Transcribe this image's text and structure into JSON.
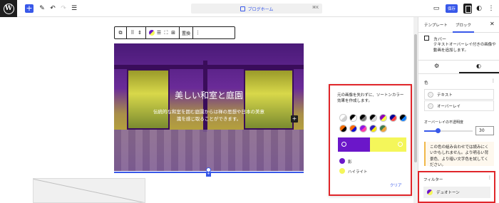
{
  "topbar": {
    "command_label": "ブログホーム",
    "command_shortcut": "⌘K",
    "save_label": "保存"
  },
  "block_toolbar": {
    "replace_label": "置換"
  },
  "cover": {
    "title": "美しい和室と庭園",
    "description": "伝統的な和室を囲む庭園からは禅の思想や日本の美意識を感じ取ることができます。"
  },
  "duotone": {
    "description": "元の画像を失わずに、ソートンカラー効果を作成します。",
    "presets": [
      {
        "a": "#ffffff",
        "b": "#d0d0d0"
      },
      {
        "a": "#000000",
        "b": "#ffffff"
      },
      {
        "a": "#000000",
        "b": "#7f7f7f"
      },
      {
        "a": "#000000",
        "b": "#d8d8d8"
      },
      {
        "a": "#8c00b7",
        "b": "#fcff41"
      },
      {
        "a": "#000097",
        "b": "#ff4747"
      },
      {
        "a": "#000000",
        "b": "#1582ff"
      },
      {
        "a": "#f46b00",
        "b": "#000000"
      },
      {
        "a": "#ff6900",
        "b": "#0d0ed0"
      },
      {
        "a": "#8f16e4",
        "b": "#ff3dac"
      },
      {
        "a": "#2d1bbd",
        "b": "#f8e80b"
      },
      {
        "a": "#3f7d4f",
        "b": "#f0a63a"
      }
    ],
    "shadow_color": "#6b16c9",
    "highlight_color": "#f4f65a",
    "shadow_label": "影",
    "highlight_label": "ハイライト",
    "clear_label": "クリア"
  },
  "sidebar": {
    "tab_template": "テンプレート",
    "tab_block": "ブロック",
    "block_title": "カバー",
    "block_description": "テキストオーバーレイ付きの画像や動画を追加します。",
    "color_section": "色",
    "color_items": [
      "テキスト",
      "オーバーレイ"
    ],
    "opacity_label": "オーバーレイの不透明度",
    "opacity_value": "30",
    "notice": "この色の組み合わせでは読みにくいかもしれません。より明るい背景色、より暗い文字色を試してください。",
    "filter_section": "フィルター",
    "filter_item": "デュオトーン"
  }
}
